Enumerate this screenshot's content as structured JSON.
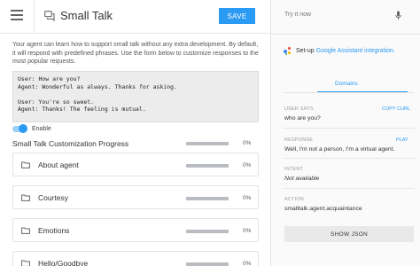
{
  "header": {
    "title": "Small Talk",
    "save_label": "SAVE"
  },
  "main": {
    "description": "Your agent can learn how to support small talk without any extra development. By default, it will respond with predefined phrases. Use the form below to customize responses to the most popular requests.",
    "example": "User: How are you?\nAgent: Wonderful as always. Thanks for asking.\n\nUser: You're so sweet.\nAgent: Thanks! The feeling is mutual.",
    "enable_label": "Enable",
    "enabled": true,
    "progress_title": "Small Talk Customization Progress",
    "overall_percent": "0%",
    "overall_progress": 0,
    "topics": [
      {
        "label": "About agent",
        "percent": "0%",
        "progress": 0
      },
      {
        "label": "Courtesy",
        "percent": "0%",
        "progress": 0
      },
      {
        "label": "Emotions",
        "percent": "0%",
        "progress": 0
      },
      {
        "label": "Hello/Goodbye",
        "percent": "0%",
        "progress": 0
      }
    ]
  },
  "side": {
    "try_placeholder": "Try it now",
    "setup_prefix": "Set-up",
    "setup_link": "Google Assistant integration.",
    "tab_label": "Domains",
    "user_says_label": "USER SAYS",
    "copy_curl": "COPY CURL",
    "user_says_value": "who are you?",
    "response_label": "RESPONSE",
    "play_label": "PLAY",
    "response_value": "Well, I'm not a person, I'm a virtual agent.",
    "intent_label": "INTENT",
    "intent_value": "Not available",
    "action_label": "ACTION",
    "action_value": "smalltalk.agent.acquaintance",
    "show_json": "SHOW JSON"
  },
  "colors": {
    "accent": "#2b9af3",
    "bar": "#b9bcc0"
  }
}
